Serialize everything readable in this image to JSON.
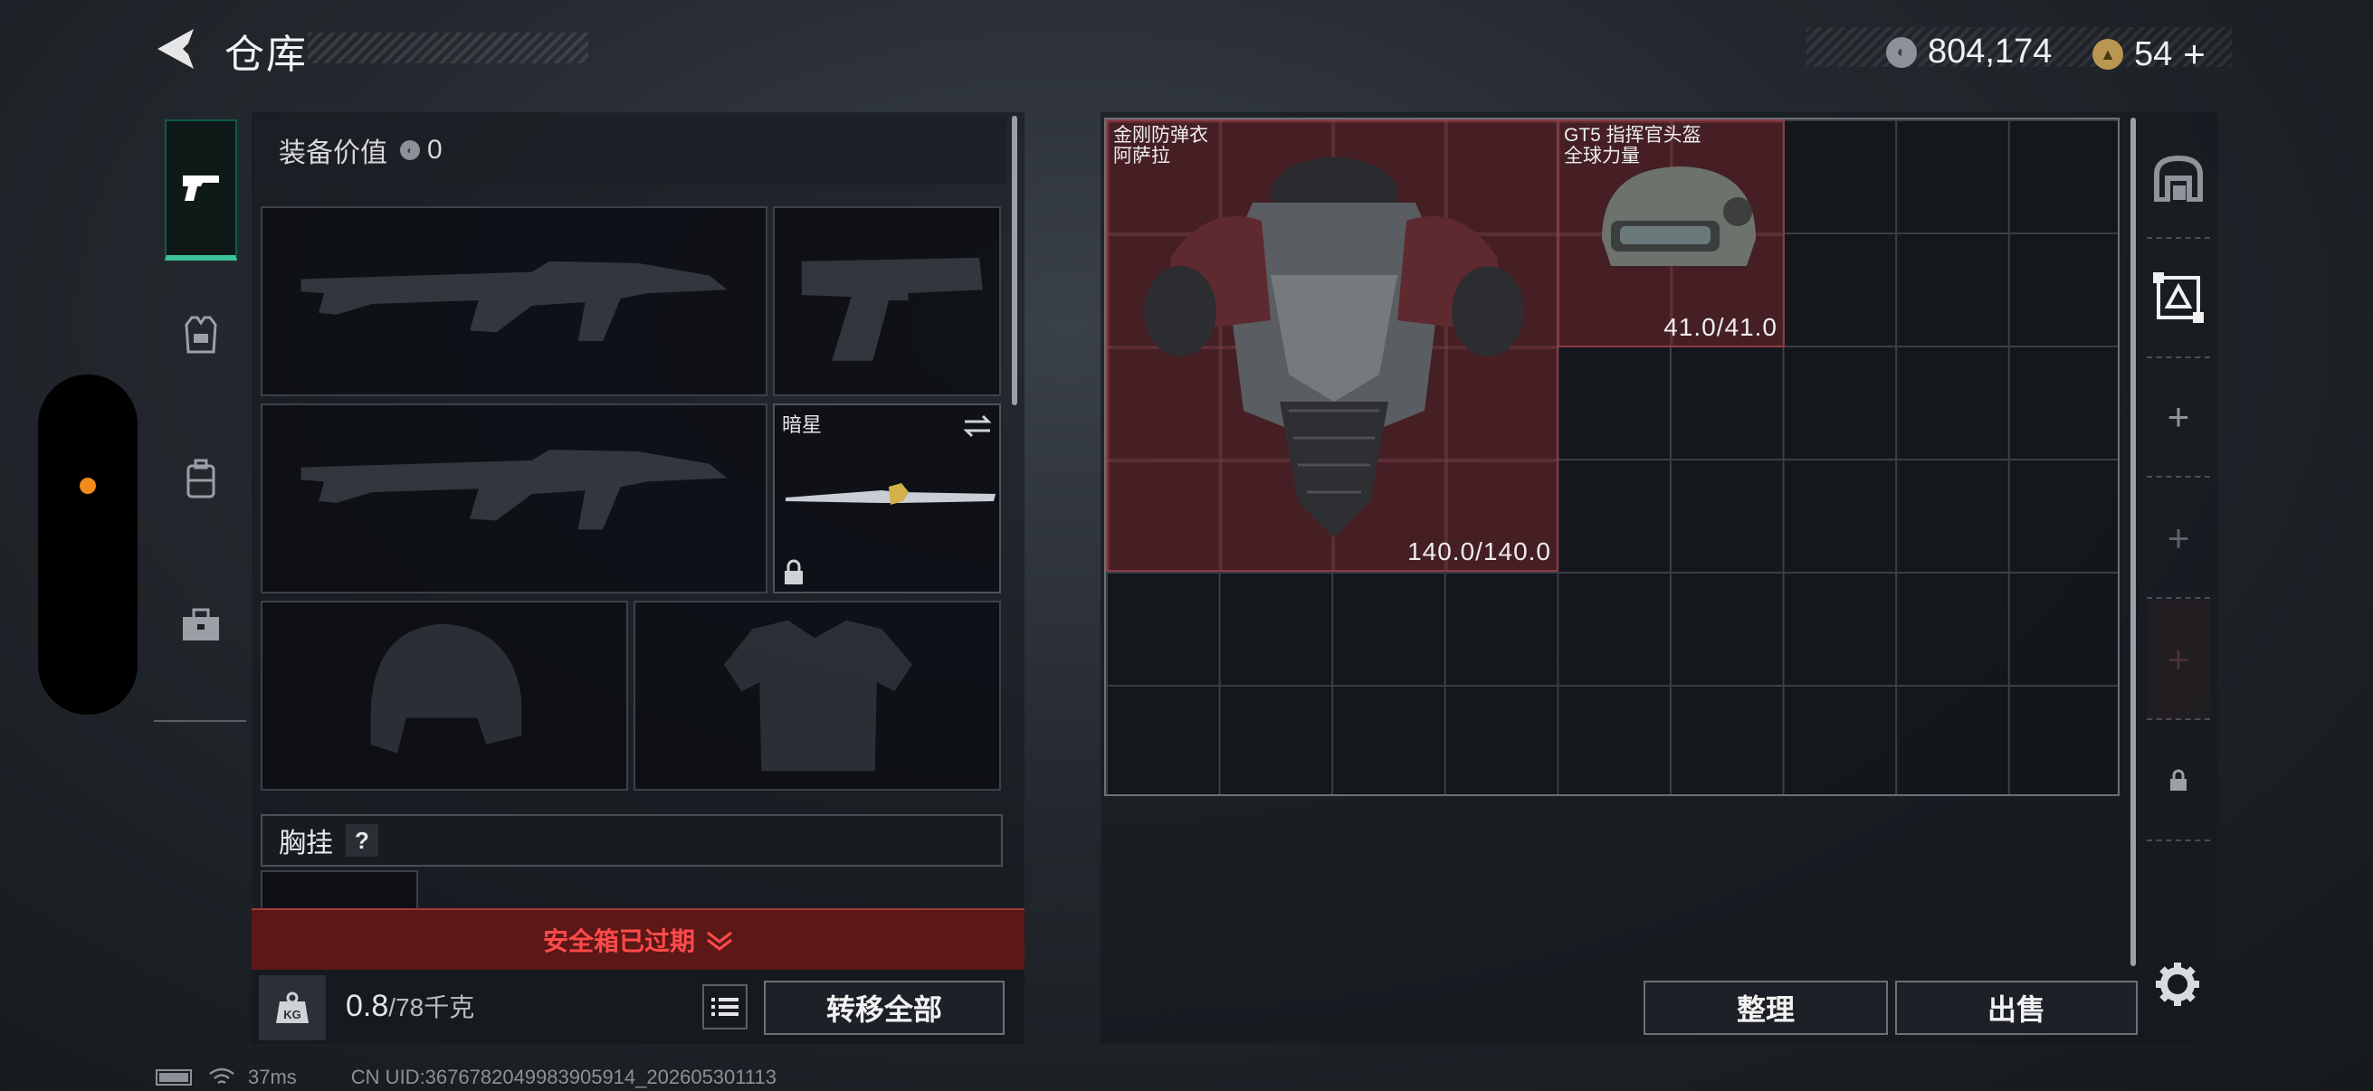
{
  "header": {
    "title": "仓库",
    "currency_silver": "804,174",
    "currency_gold": "54",
    "add_label": "+"
  },
  "side_tabs": [
    {
      "icon": "pistol-icon",
      "active": true
    },
    {
      "icon": "vest-icon",
      "active": false
    },
    {
      "icon": "backpack-icon",
      "active": false
    },
    {
      "icon": "toolbox-icon",
      "active": false
    }
  ],
  "equipment": {
    "value_label": "装备价值",
    "value": "0",
    "melee_name": "暗星",
    "chest_rig_label": "胸挂",
    "help_label": "?"
  },
  "safebox": {
    "expired_label": "安全箱已过期"
  },
  "capacity": {
    "current": "0.8",
    "max_text": "/78千克",
    "kg_label": "KG"
  },
  "buttons": {
    "transfer_all": "转移全部",
    "sort": "整理",
    "sell": "出售"
  },
  "stash_items": [
    {
      "name_line1": "金刚防弹衣",
      "name_line2": "阿萨拉",
      "durability": "140.0/140.0"
    },
    {
      "name_line1": "GT5 指挥官头盔",
      "name_line2": "全球力量",
      "durability": "41.0/41.0"
    }
  ],
  "stash_side": [
    {
      "icon": "stash-home-icon",
      "label": ""
    },
    {
      "icon": "stash-tab-icon",
      "label": ""
    },
    {
      "icon": "add-icon",
      "label": "+"
    },
    {
      "icon": "add-icon",
      "label": "+"
    },
    {
      "icon": "add-icon",
      "label": "+"
    },
    {
      "icon": "lock-icon",
      "label": ""
    }
  ],
  "status": {
    "ping": "37ms",
    "uid": "CN UID:3676782049983905914_202605301113"
  },
  "colors": {
    "accent_green": "#3ec49a",
    "expired_red": "#ff4a4a",
    "item_red": "#8c3c44",
    "orange_dot": "#f28a1c"
  }
}
